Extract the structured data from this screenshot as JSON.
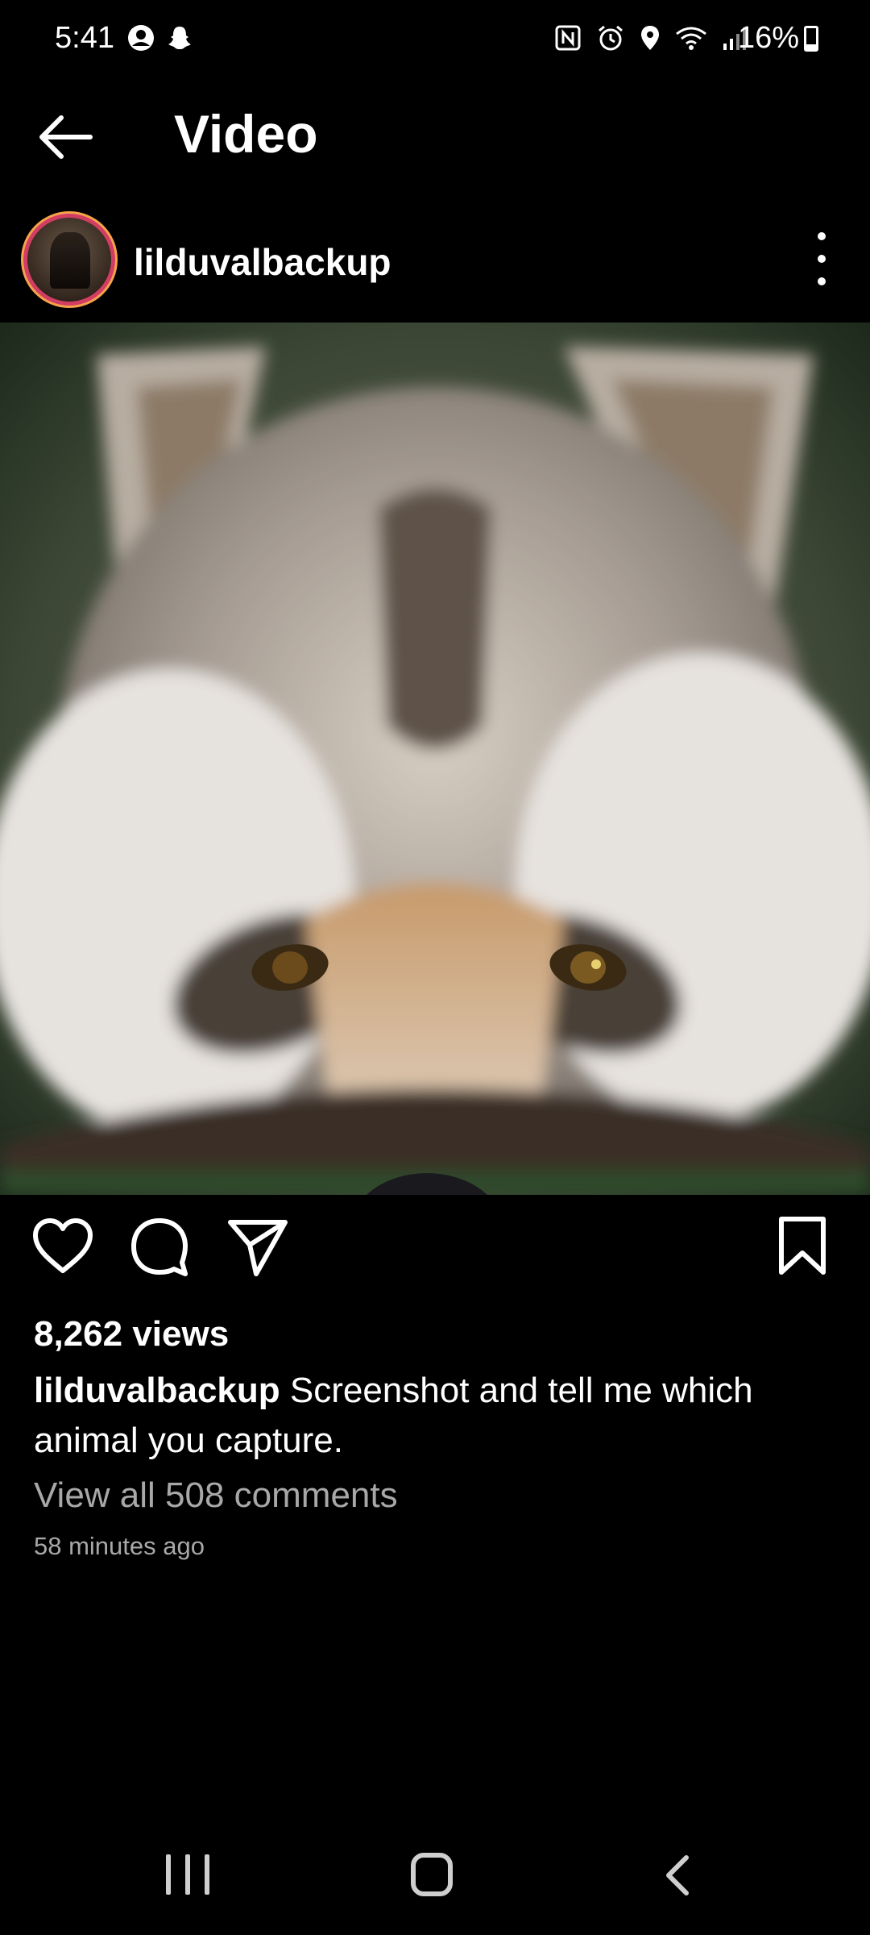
{
  "status_bar": {
    "time": "5:41",
    "battery": "16%",
    "left_icons": [
      "account-circle-icon",
      "snapchat-icon"
    ],
    "right_icons": [
      "nfc-icon",
      "alarm-icon",
      "location-icon",
      "wifi-icon",
      "signal-icon",
      "battery-icon"
    ]
  },
  "header": {
    "title": "Video",
    "back_icon": "arrow-left-icon"
  },
  "post": {
    "username": "lilduvalbackup",
    "media": {
      "icon": "video-frame"
    },
    "views": "8,262 views",
    "caption_user": "lilduvalbackup",
    "caption_text": " Screenshot and tell me which animal you capture.",
    "view_comments": "View all 508 comments",
    "time_ago": "58 minutes ago"
  },
  "actions": {
    "icons": [
      "heart-icon",
      "comment-icon",
      "send-icon",
      "bookmark-icon"
    ]
  },
  "nav_bar": {
    "icons": [
      "recent-apps-icon",
      "home-icon",
      "back-icon"
    ]
  },
  "colors": {
    "background": "#000000",
    "text": "#ffffff",
    "muted": "#a8a8a8",
    "story_ring_start": "#d23d64",
    "story_ring_end": "#f5a34a"
  }
}
